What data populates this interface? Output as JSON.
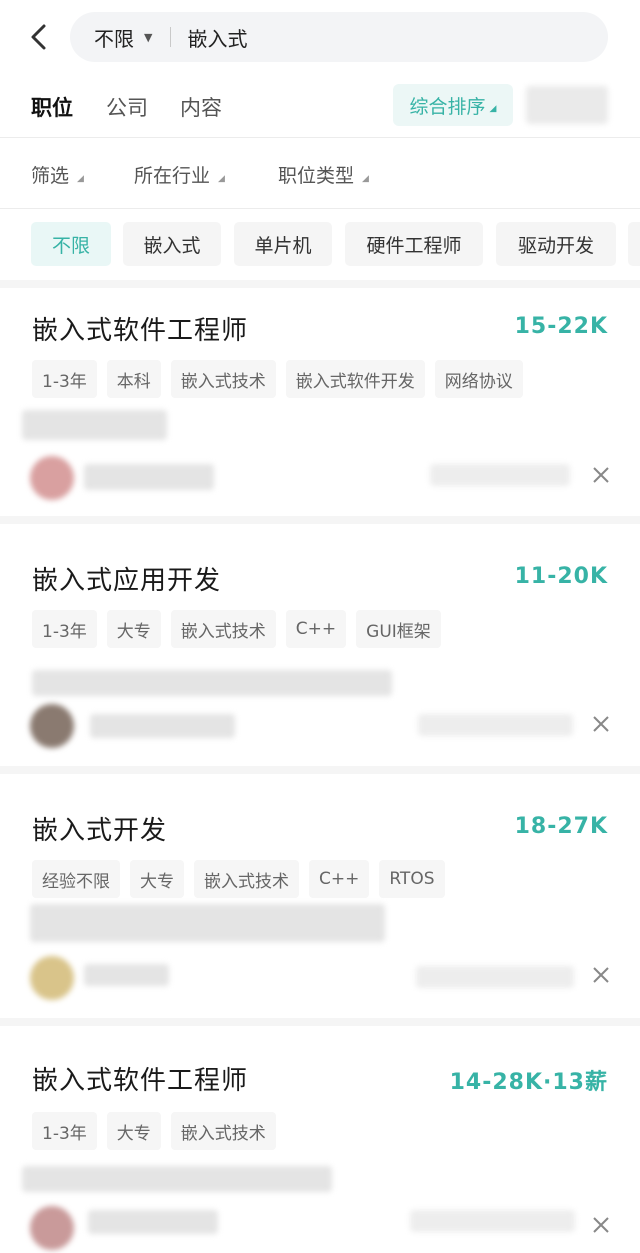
{
  "search": {
    "scope_label": "不限",
    "query": "嵌入式"
  },
  "tabs": [
    {
      "label": "职位",
      "active": true
    },
    {
      "label": "公司",
      "active": false
    },
    {
      "label": "内容",
      "active": false
    }
  ],
  "sort": {
    "label": "综合排序"
  },
  "filters": [
    "筛选",
    "所在行业",
    "职位类型"
  ],
  "chips": [
    {
      "label": "不限",
      "active": true
    },
    {
      "label": "嵌入式",
      "active": false
    },
    {
      "label": "单片机",
      "active": false
    },
    {
      "label": "硬件工程师",
      "active": false
    },
    {
      "label": "驱动开发",
      "active": false
    }
  ],
  "jobs": [
    {
      "title": "嵌入式软件工程师",
      "salary": "15-22K",
      "tags": [
        "1-3年",
        "本科",
        "嵌入式技术",
        "嵌入式软件开发",
        "网络协议"
      ]
    },
    {
      "title": "嵌入式应用开发",
      "salary": "11-20K",
      "tags": [
        "1-3年",
        "大专",
        "嵌入式技术",
        "C++",
        "GUI框架"
      ]
    },
    {
      "title": "嵌入式开发",
      "salary": "18-27K",
      "tags": [
        "经验不限",
        "大专",
        "嵌入式技术",
        "C++",
        "RTOS"
      ]
    },
    {
      "title": "嵌入式软件工程师",
      "salary": "14-28K·13薪",
      "tags": [
        "1-3年",
        "大专",
        "嵌入式技术"
      ]
    }
  ],
  "colors": {
    "accent": "#37b3a6",
    "chip_bg": "#f5f5f5",
    "text": "#222222"
  }
}
